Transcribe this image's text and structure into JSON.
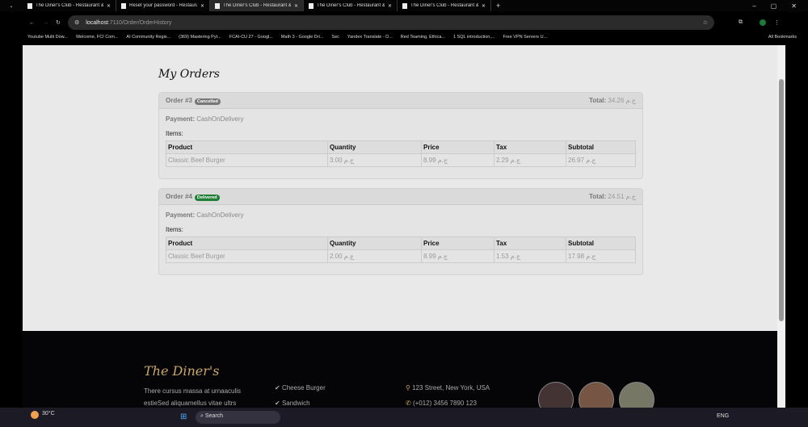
{
  "browser": {
    "tabs": [
      {
        "title": "The Diner's Club - Restaurant &",
        "active": false
      },
      {
        "title": "Reset your password - Restaura",
        "active": false
      },
      {
        "title": "The Diner's Club - Restaurant &",
        "active": true
      },
      {
        "title": "The Diner's Club - Restaurant &",
        "active": false
      },
      {
        "title": "The Diner's Club - Restaurant &",
        "active": false
      }
    ],
    "url_host": "localhost",
    "url_path": ":7110/Order/OrderHistory",
    "bookmarks": [
      "Youtube Multi Dow...",
      "Welcome, FCI Com...",
      "AI Community Regis...",
      "(369) Mastering Pyt...",
      "FCAI-CU 27 - Googl...",
      "Math 3 - Google Dri...",
      "Sec",
      "Yandex Translate - D...",
      "Red Teaming, Ethica...",
      "1 SQL introduction,...",
      "Free VPN Servers U..."
    ],
    "all_bookmarks": "All Bookmarks"
  },
  "page": {
    "title": "My Orders",
    "labels": {
      "total": "Total:",
      "payment": "Payment:",
      "items": "Items:"
    },
    "columns": [
      "Product",
      "Quantity",
      "Price",
      "Tax",
      "Subtotal"
    ],
    "orders": [
      {
        "number": "Order #3",
        "status": "Cancelled",
        "status_color": "#777777",
        "total": "34.26 ج.م",
        "payment": "CashOnDelivery",
        "rows": [
          [
            "Classic Beef Burger",
            "3.00 ج.م",
            "8.99 ج.م",
            "2.29 ج.م",
            "26.97 ج.م"
          ]
        ]
      },
      {
        "number": "Order #4",
        "status": "Delivered",
        "status_color": "#1e7e34",
        "total": "24.51 ج.م",
        "payment": "CashOnDelivery",
        "rows": [
          [
            "Classic Beef Burger",
            "2.00 ج.م",
            "8.99 ج.م",
            "1.53 ج.م",
            "17.98 ج.م"
          ]
        ]
      }
    ]
  },
  "footer": {
    "logo": "The Diner's",
    "about1": "There cursus massa at urnaaculis",
    "about2": "estieSed aliquamellus vitae ultrs",
    "menu": [
      "Cheese Burger",
      "Sandwich"
    ],
    "address": "123 Street, New York, USA",
    "phone": "(+012) 3456 7890 123"
  },
  "taskbar": {
    "weather": "30°C",
    "search": "Search",
    "lang": "ENG"
  }
}
